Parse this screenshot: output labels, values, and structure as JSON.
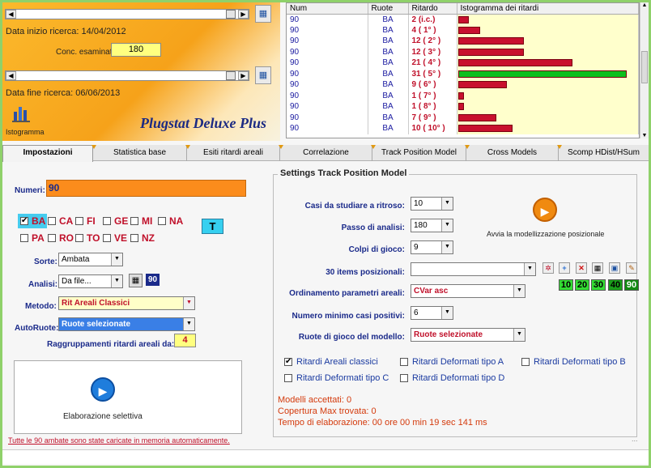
{
  "top": {
    "date_start_label": "Data inizio ricerca: 14/04/2012",
    "conc_label": "Conc. esaminati",
    "conc_value": "180",
    "date_end_label": "Data fine ricerca: 06/06/2013",
    "istogramma_label": "Istogramma",
    "brand": "Plugstat Deluxe Plus"
  },
  "grid": {
    "headers": [
      "Num",
      "Ruote",
      "Ritardo",
      "Istogramma dei ritardi"
    ],
    "rows": [
      {
        "num": "90",
        "ruota": "BA",
        "rit": "2  (i.c.)",
        "value": 2,
        "color": "#c8102e"
      },
      {
        "num": "90",
        "ruota": "BA",
        "rit": "4  ( 1° )",
        "value": 4,
        "color": "#c8102e"
      },
      {
        "num": "90",
        "ruota": "BA",
        "rit": "12  ( 2° )",
        "value": 12,
        "color": "#c8102e"
      },
      {
        "num": "90",
        "ruota": "BA",
        "rit": "12  ( 3° )",
        "value": 12,
        "color": "#c8102e"
      },
      {
        "num": "90",
        "ruota": "BA",
        "rit": "21  ( 4° )",
        "value": 21,
        "color": "#c8102e"
      },
      {
        "num": "90",
        "ruota": "BA",
        "rit": "31  ( 5° )",
        "value": 31,
        "color": "#0bbf1e"
      },
      {
        "num": "90",
        "ruota": "BA",
        "rit": "9  ( 6° )",
        "value": 9,
        "color": "#c8102e"
      },
      {
        "num": "90",
        "ruota": "BA",
        "rit": "1  ( 7° )",
        "value": 1,
        "color": "#c8102e"
      },
      {
        "num": "90",
        "ruota": "BA",
        "rit": "1  ( 8° )",
        "value": 1,
        "color": "#c8102e"
      },
      {
        "num": "90",
        "ruota": "BA",
        "rit": "7  ( 9° )",
        "value": 7,
        "color": "#c8102e"
      },
      {
        "num": "90",
        "ruota": "BA",
        "rit": "10  ( 10° )",
        "value": 10,
        "color": "#c8102e"
      }
    ],
    "max_value": 31
  },
  "tabs": [
    "Impostazioni",
    "Statistica base",
    "Esiti ritardi areali",
    "Correlazione",
    "Track Position Model",
    "Cross Models",
    "Scomp HDist/HSum"
  ],
  "left": {
    "numeri_label": "Numeri:",
    "numeri_value": "90",
    "ruote_row1": [
      {
        "label": "BA",
        "checked": true
      },
      {
        "label": "CA",
        "checked": false
      },
      {
        "label": "FI",
        "checked": false
      },
      {
        "label": "GE",
        "checked": false
      },
      {
        "label": "MI",
        "checked": false
      },
      {
        "label": "NA",
        "checked": false
      }
    ],
    "ruote_row2": [
      {
        "label": "PA",
        "checked": false
      },
      {
        "label": "RO",
        "checked": false
      },
      {
        "label": "TO",
        "checked": false
      },
      {
        "label": "VE",
        "checked": false
      },
      {
        "label": "NZ",
        "checked": false
      }
    ],
    "t_button": "T",
    "sorte_label": "Sorte:",
    "sorte_value": "Ambata",
    "analisi_label": "Analisi:",
    "analisi_value": "Da file...",
    "analisi_badge": "90",
    "metodo_label": "Metodo:",
    "metodo_value": "Rit Areali Classici",
    "autoruote_label": "AutoRuote:",
    "autoruote_value": "Ruote selezionate",
    "raggruppamenti_label": "Raggruppamenti ritardi areali da:",
    "raggruppamenti_value": "4",
    "elaborazione_label": "Elaborazione selettiva",
    "footer_note": "Tutte le 90 ambate sono state caricate in memoria automaticamente."
  },
  "right": {
    "legend": "Settings Track Position Model",
    "casi_label": "Casi da studiare a ritroso:",
    "casi_value": "10",
    "passo_label": "Passo di analisi:",
    "passo_value": "180",
    "colpi_label": "Colpi di gioco:",
    "colpi_value": "9",
    "items_label": "30 items posizionali:",
    "items_value": "",
    "ordinamento_label": "Ordinamento parametri areali:",
    "ordinamento_value": "CVar asc",
    "numero_label": "Numero minimo casi positivi:",
    "numero_value": "6",
    "ruote_label": "Ruote di gioco del modello:",
    "ruote_value": "Ruote selezionate",
    "avvia_label": "Avvia la modellizzazione posizionale",
    "green_buttons": [
      "10",
      "20",
      "30",
      "40",
      "90"
    ],
    "options": [
      {
        "label": "Ritardi Areali classici",
        "checked": true
      },
      {
        "label": "Ritardi Deformati tipo A",
        "checked": false
      },
      {
        "label": "Ritardi Deformati tipo B",
        "checked": false
      },
      {
        "label": "Ritardi Deformati tipo C",
        "checked": false
      },
      {
        "label": "Ritardi Deformati tipo D",
        "checked": false
      }
    ],
    "status_models": "Modelli accettati: 0",
    "status_copertura": "Copertura Max trovata: 0",
    "status_tempo": "Tempo di elaborazione: 00 ore 00 min 19 sec 141 ms"
  },
  "bottom_dots": "..."
}
